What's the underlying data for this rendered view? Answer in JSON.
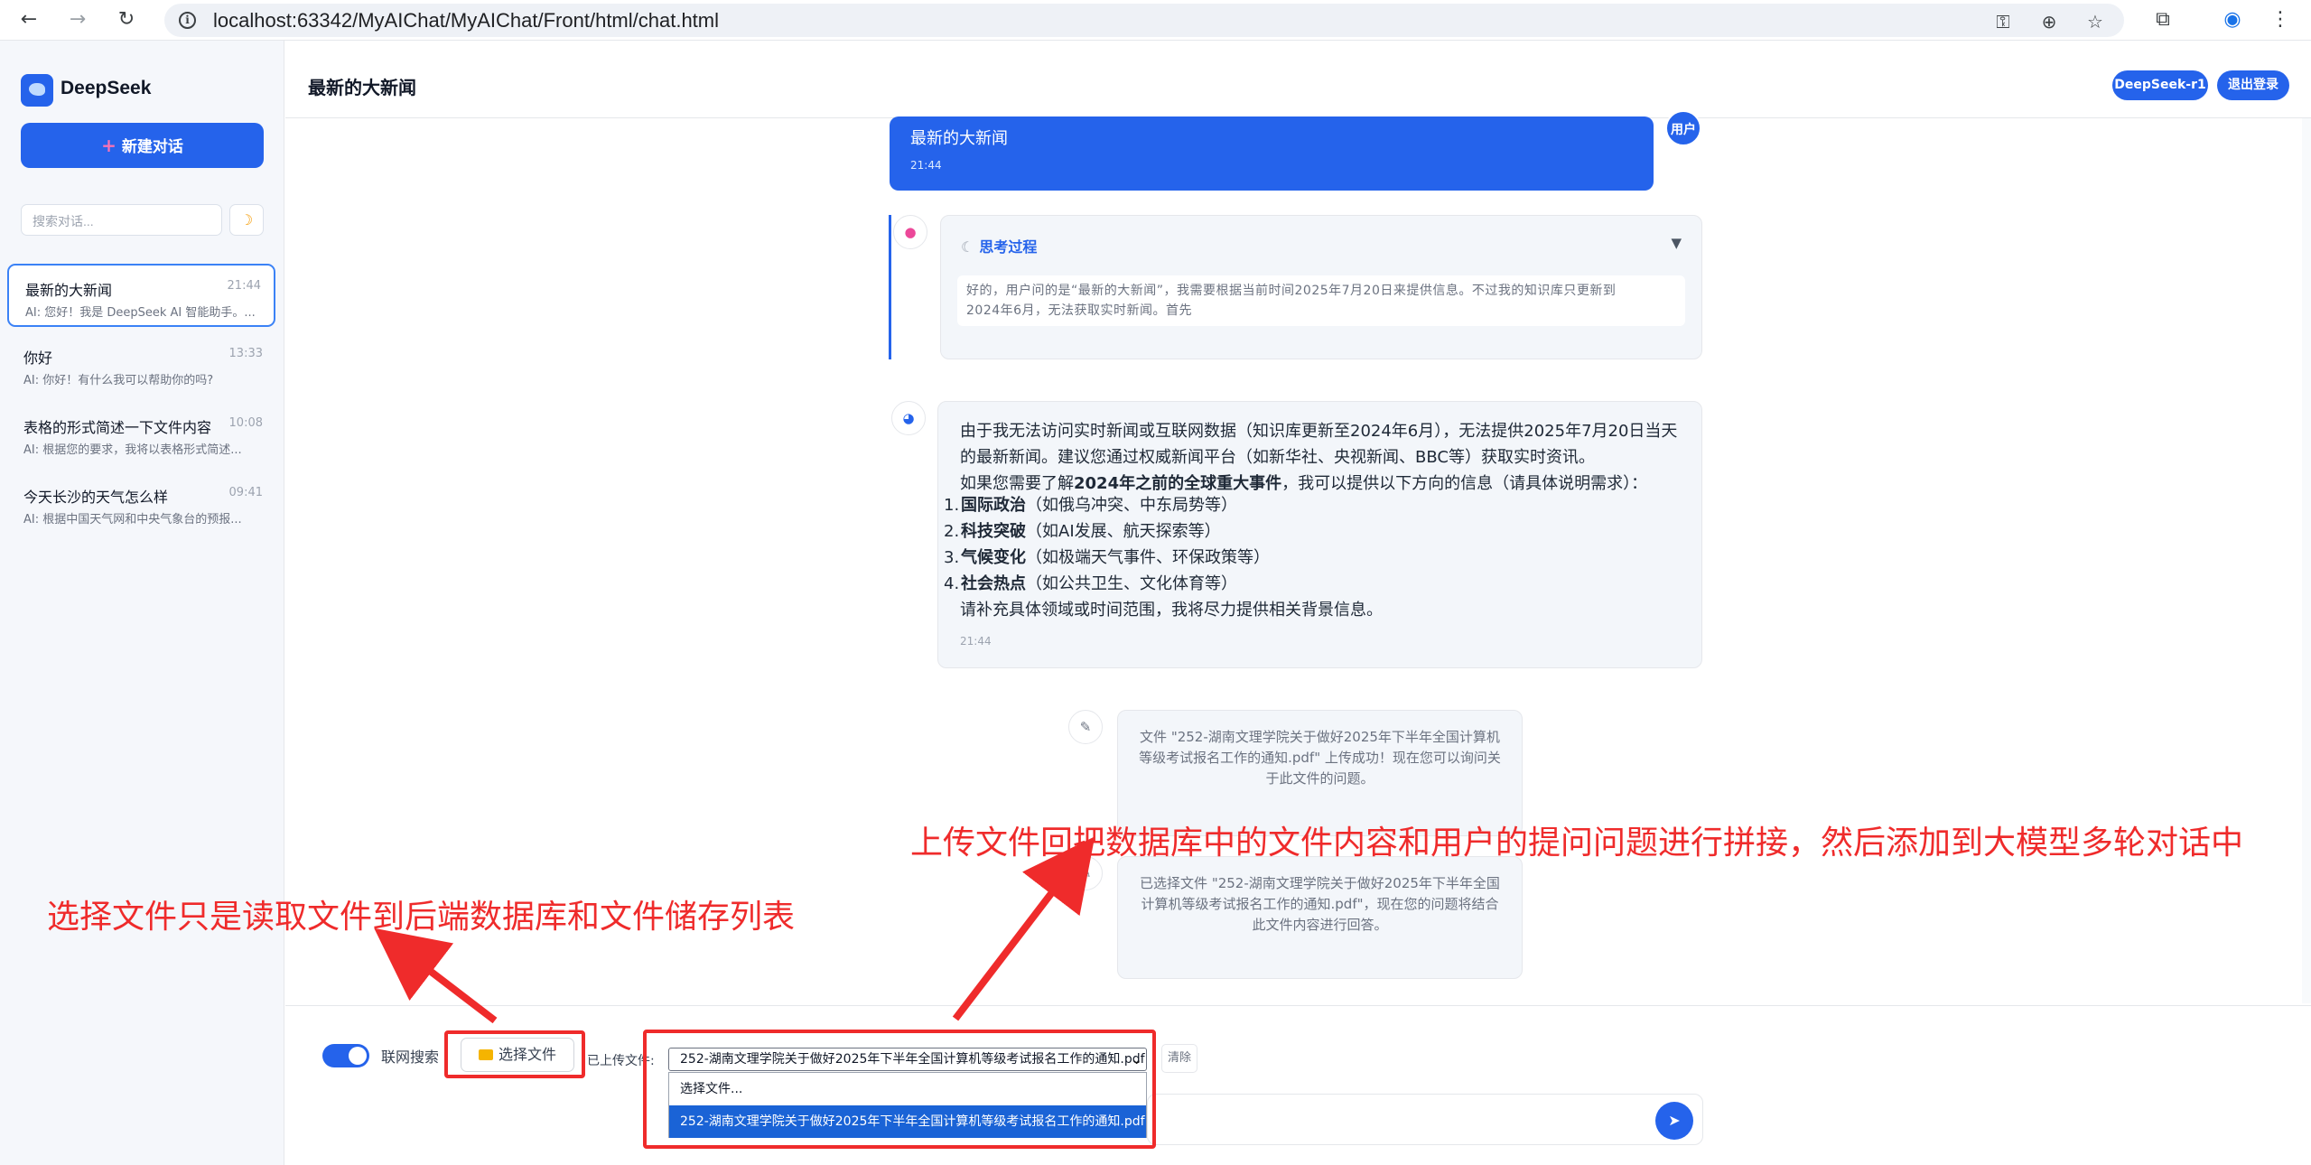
{
  "browser": {
    "url": "localhost:63342/MyAIChat/MyAIChat/Front/html/chat.html",
    "back_icon": "←",
    "forward_icon": "→",
    "reload_icon": "↻",
    "info_icon": "i",
    "key_icon": "⚿",
    "zoom_icon": "⊕",
    "star_icon": "☆",
    "ext_icon": "⧉",
    "profile_icon": "◉",
    "menu_icon": "⋮"
  },
  "sidebar": {
    "brand": "DeepSeek",
    "new_chat_plus": "+",
    "new_chat_label": "新建对话",
    "search_placeholder": "搜索对话...",
    "theme_icon": "☽",
    "conversations": [
      {
        "title": "最新的大新闻",
        "time": "21:44",
        "preview": "AI: 您好！我是 DeepSeek AI 智能助手。..."
      },
      {
        "title": "你好",
        "time": "13:33",
        "preview": "AI: 你好！有什么我可以帮助你的吗?"
      },
      {
        "title": "表格的形式简述一下文件内容",
        "time": "10:08",
        "preview": "AI: 根据您的要求，我将以表格形式简述..."
      },
      {
        "title": "今天长沙的天气怎么样",
        "time": "09:41",
        "preview": "AI: 根据中国天气网和中央气象台的预报..."
      }
    ]
  },
  "header": {
    "title": "最新的大新闻",
    "model_label": "DeepSeek-r1",
    "logout_label": "退出登录"
  },
  "messages": {
    "user_avatar": "用户",
    "user_text": "最新的大新闻",
    "user_time": "21:44",
    "think_icon": "☾",
    "think_title": "思考过程",
    "think_caret": "▼",
    "think_line1": "好的，用户问的是“最新的大新闻”，我需要根据当前时间2025年7月20日来提供信息。不过我的知识库只更新到",
    "think_line2": "2024年6月，无法获取实时新闻。首先",
    "ai_para1": "由于我无法访问实时新闻或互联网数据（知识库更新至2024年6月），无法提供2025年7月20日当天的最新新闻。建议您通过权威新闻平台（如新华社、央视新闻、BBC等）获取实时资讯。",
    "ai_para2_pre": "如果您需要了解",
    "ai_para2_bold": "2024年之前的全球重大事件",
    "ai_para2_post": "，我可以提供以下方向的信息（请具体说明需求）：",
    "ai_list": [
      {
        "num": "1.",
        "bold": "国际政治",
        "rest": "（如俄乌冲突、中东局势等）"
      },
      {
        "num": "2.",
        "bold": "科技突破",
        "rest": "（如AI发展、航天探索等）"
      },
      {
        "num": "3.",
        "bold": "气候变化",
        "rest": "（如极端天气事件、环保政策等）"
      },
      {
        "num": "4.",
        "bold": "社会热点",
        "rest": "（如公共卫生、文化体育等）"
      }
    ],
    "ai_closing": "请补充具体领域或时间范围，我将尽力提供相关背景信息。",
    "ai_time": "21:44",
    "sys_icon": "✎",
    "sys1_text": "文件 \"252-湖南文理学院关于做好2025年下半年全国计算机等级考试报名工作的通知.pdf\" 上传成功！现在您可以询问关于此文件的问题。",
    "sys2_text": "已选择文件 \"252-湖南文理学院关于做好2025年下半年全国计算机等级考试报名工作的通知.pdf\"，现在您的问题将结合此文件内容进行回答。"
  },
  "annotations": {
    "right": "上传文件回把数据库中的文件内容和用户的提问问题进行拼接，然后添加到大模型多轮对话中",
    "left": "选择文件只是读取文件到后端数据库和文件储存列表"
  },
  "input": {
    "web_search_label": "联网搜索",
    "web_search_on": true,
    "file_button_label": "选择文件",
    "uploaded_label": "已上传文件:",
    "selected_file": "252-湖南文理学院关于做好2025年下半年全国计算机等级考试报名工作的通知.pdf",
    "select_chevron": "⌄",
    "clear_label": "清除",
    "options": [
      "选择文件...",
      "252-湖南文理学院关于做好2025年下半年全国计算机等级考试报名工作的通知.pdf"
    ],
    "send_icon": "➤"
  }
}
